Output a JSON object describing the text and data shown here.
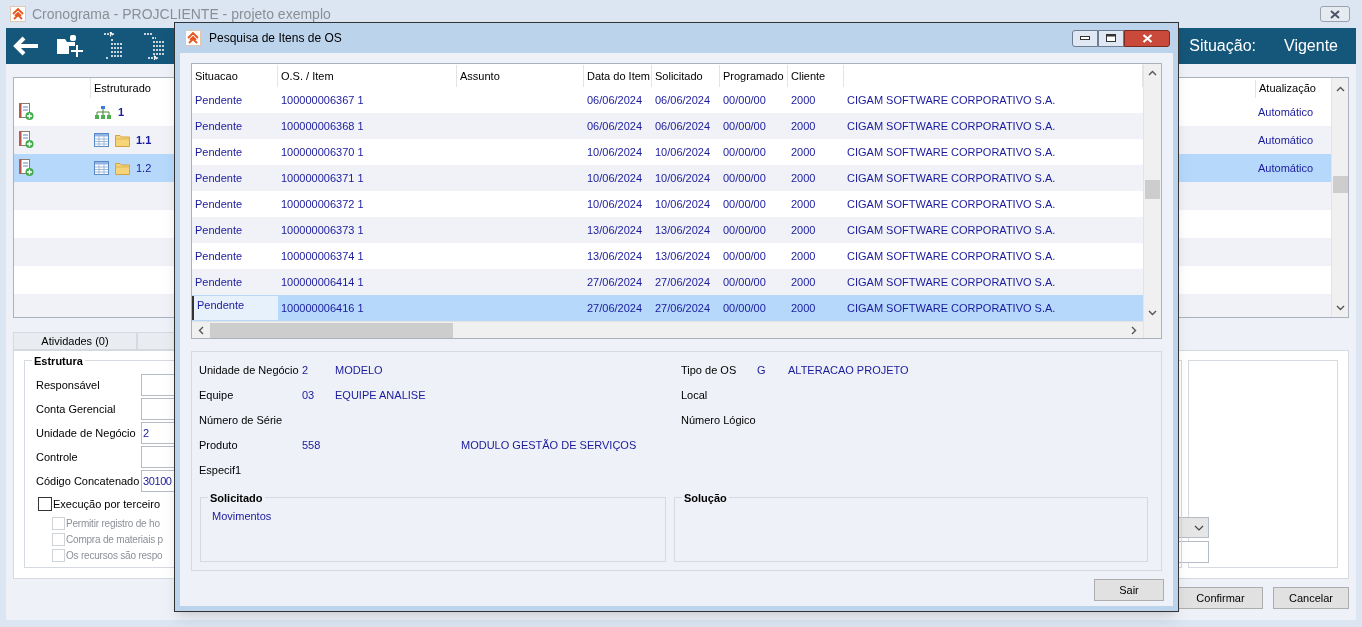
{
  "main_window": {
    "title": "Cronograma - PROJCLIENTE - projeto exemplo",
    "situation_label": "Situação:",
    "situation_value": "Vigente"
  },
  "structure_grid": {
    "columns": [
      "Estruturado",
      "Atualização"
    ],
    "rows": [
      {
        "kind": "root",
        "code": "1",
        "bold": true,
        "update": "Automático",
        "selected": false
      },
      {
        "kind": "item",
        "code": "1.1",
        "bold": true,
        "update": "Automático",
        "selected": false
      },
      {
        "kind": "item",
        "code": "1.2",
        "bold": false,
        "update": "Automático",
        "selected": true
      }
    ]
  },
  "tabs": [
    {
      "label": "Atividades (0)"
    }
  ],
  "structure_panel": {
    "title": "Estrutura",
    "fields": [
      {
        "label": "Responsável"
      },
      {
        "label": "Conta Gerencial"
      },
      {
        "label": "Unidade de Negócio",
        "value": "2"
      },
      {
        "label": "Controle"
      },
      {
        "label": "Código Concatenado",
        "value": "30100"
      }
    ],
    "checkboxes": [
      {
        "label": "Execução por terceiro",
        "checked": false,
        "disabled": false
      },
      {
        "label": "Permitir registro de ho",
        "checked": false,
        "disabled": true
      },
      {
        "label": "Compra de materiais p",
        "checked": false,
        "disabled": true
      },
      {
        "label": "Os recursos são respo",
        "checked": false,
        "disabled": true
      }
    ]
  },
  "buttons": [
    "Confirmar",
    "Cancelar"
  ],
  "dialog": {
    "title": "Pesquisa de Itens de OS",
    "columns": [
      "Situacao",
      "O.S. / Item",
      "Assunto",
      "Data do Item",
      "Solicitado",
      "Programado",
      "Cliente"
    ],
    "rows": [
      {
        "status": "Pendente",
        "os_item": "100000006367 1",
        "item_date": "06/06/2024",
        "requested": "06/06/2024",
        "scheduled": "00/00/00",
        "client_code": "2000",
        "client_name": "CIGAM SOFTWARE CORPORATIVO S.A.",
        "selected": false
      },
      {
        "status": "Pendente",
        "os_item": "100000006368 1",
        "item_date": "06/06/2024",
        "requested": "06/06/2024",
        "scheduled": "00/00/00",
        "client_code": "2000",
        "client_name": "CIGAM SOFTWARE CORPORATIVO S.A.",
        "selected": false
      },
      {
        "status": "Pendente",
        "os_item": "100000006370 1",
        "item_date": "10/06/2024",
        "requested": "10/06/2024",
        "scheduled": "00/00/00",
        "client_code": "2000",
        "client_name": "CIGAM SOFTWARE CORPORATIVO S.A.",
        "selected": false
      },
      {
        "status": "Pendente",
        "os_item": "100000006371 1",
        "item_date": "10/06/2024",
        "requested": "10/06/2024",
        "scheduled": "00/00/00",
        "client_code": "2000",
        "client_name": "CIGAM SOFTWARE CORPORATIVO S.A.",
        "selected": false
      },
      {
        "status": "Pendente",
        "os_item": "100000006372 1",
        "item_date": "10/06/2024",
        "requested": "10/06/2024",
        "scheduled": "00/00/00",
        "client_code": "2000",
        "client_name": "CIGAM SOFTWARE CORPORATIVO S.A.",
        "selected": false
      },
      {
        "status": "Pendente",
        "os_item": "100000006373 1",
        "item_date": "13/06/2024",
        "requested": "13/06/2024",
        "scheduled": "00/00/00",
        "client_code": "2000",
        "client_name": "CIGAM SOFTWARE CORPORATIVO S.A.",
        "selected": false
      },
      {
        "status": "Pendente",
        "os_item": "100000006374 1",
        "item_date": "13/06/2024",
        "requested": "13/06/2024",
        "scheduled": "00/00/00",
        "client_code": "2000",
        "client_name": "CIGAM SOFTWARE CORPORATIVO S.A.",
        "selected": false
      },
      {
        "status": "Pendente",
        "os_item": "100000006414 1",
        "item_date": "27/06/2024",
        "requested": "27/06/2024",
        "scheduled": "00/00/00",
        "client_code": "2000",
        "client_name": "CIGAM SOFTWARE CORPORATIVO S.A.",
        "selected": false
      },
      {
        "status": "Pendente",
        "os_item": "100000006416 1",
        "item_date": "27/06/2024",
        "requested": "27/06/2024",
        "scheduled": "00/00/00",
        "client_code": "2000",
        "client_name": "CIGAM SOFTWARE CORPORATIVO S.A.",
        "selected": true
      }
    ],
    "details_left": [
      {
        "label": "Unidade de Negócio",
        "code": "2",
        "value": "MODELO"
      },
      {
        "label": "Equipe",
        "code": "03",
        "value": "EQUIPE ANALISE"
      },
      {
        "label": "Número de Série"
      },
      {
        "label": "Produto",
        "code": "558",
        "value": "MODULO GESTÃO DE SERVIÇOS",
        "kind": "wide"
      },
      {
        "label": "Especif1"
      }
    ],
    "details_right": [
      {
        "label": "Tipo de OS",
        "code": "G",
        "value": "ALTERACAO PROJETO"
      },
      {
        "label": "Local"
      },
      {
        "label": "Número Lógico"
      }
    ],
    "requested_box": {
      "title": "Solicitado",
      "text": "Movimentos"
    },
    "solution_box": {
      "title": "Solução"
    },
    "close_button": "Sair"
  }
}
